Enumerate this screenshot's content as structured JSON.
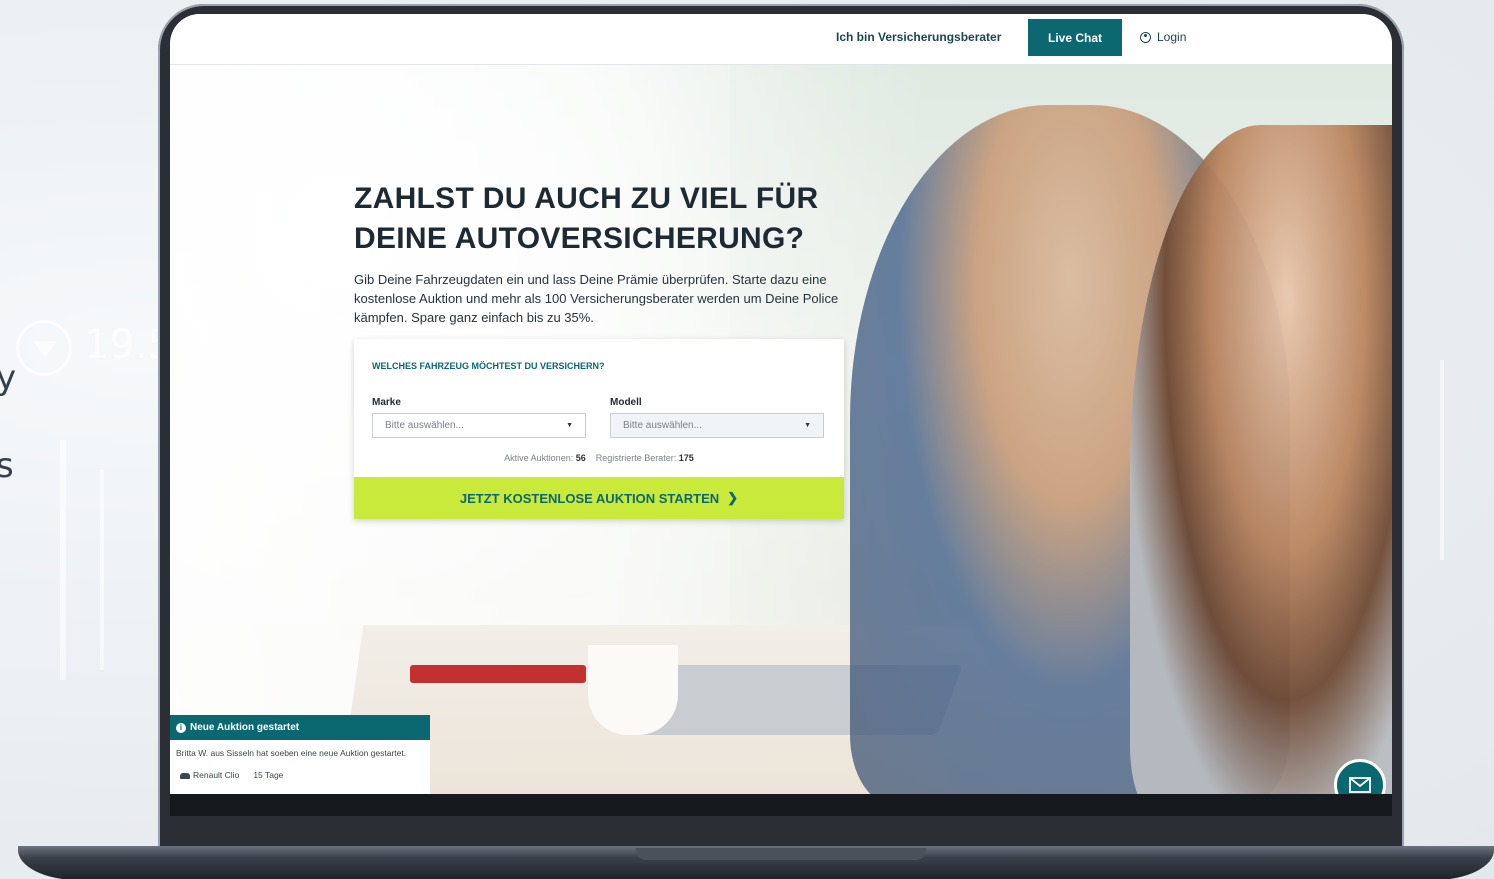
{
  "header": {
    "advisor_link": "Ich bin Versicherungsberater",
    "live_chat": "Live Chat",
    "login": "Login"
  },
  "hero": {
    "headline_line1": "ZAHLST DU AUCH ZU VIEL FÜR",
    "headline_line2": "DEINE AUTOVERSICHERUNG?",
    "intro": "Gib Deine Fahrzeugdaten ein und lass Deine Prämie überprüfen. Starte dazu eine kostenlose Auktion und mehr als 100 Versicherungsberater werden um Deine Police kämpfen. Spare ganz einfach bis zu 35%."
  },
  "form": {
    "question": "WELCHES FAHRZEUG MÖCHTEST DU VERSICHERN?",
    "brand_label": "Marke",
    "brand_placeholder": "Bitte auswählen...",
    "model_label": "Modell",
    "model_placeholder": "Bitte auswählen...",
    "active_auctions_label": "Aktive Auktionen:",
    "active_auctions_value": "56",
    "registered_advisors_label": "Registrierte Berater:",
    "registered_advisors_value": "175",
    "cta": "JETZT KOSTENLOSE AUKTION STARTEN"
  },
  "notification": {
    "title": "Neue Auktion gestartet",
    "body": "Britta W. aus Sisseln hat soeben eine neue Auktion gestartet.",
    "car": "Renault Clio",
    "duration": "15 Tage"
  },
  "background": {
    "number": "19.5",
    "letter_1": "y",
    "letter_2": "s"
  },
  "colors": {
    "brand": "#0b6870",
    "cta": "#c9ea3a"
  }
}
